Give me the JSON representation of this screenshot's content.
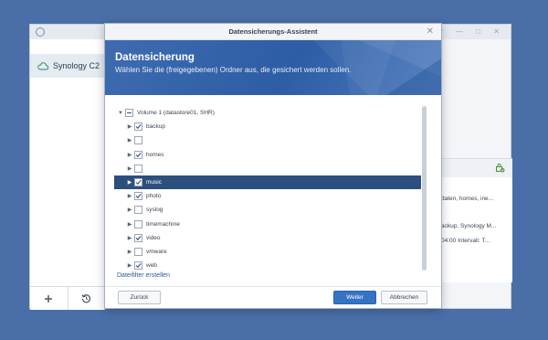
{
  "background_window": {
    "sidebar_item": "Synology C2",
    "right_panel_lines": [
      "daten, homes, ine...",
      "ackup, Synology M...",
      "04:00 Intervall: T..."
    ],
    "window_controls": "? — □ ✕"
  },
  "dialog": {
    "title": "Datensicherungs-Assistent",
    "banner_title": "Datensicherung",
    "banner_subtitle": "Wählen Sie die (freigegebenen) Ordner aus, die gesichert werden sollen.",
    "tree": [
      {
        "label": "Volume 1 (datastore01, SHR)",
        "checked": "partial",
        "caret": "▼",
        "indent": 0,
        "selected": false
      },
      {
        "label": "backup",
        "checked": "true",
        "caret": "▶",
        "indent": 1,
        "selected": false
      },
      {
        "label": "",
        "checked": "false",
        "caret": "▶",
        "indent": 1,
        "selected": false
      },
      {
        "label": "homes",
        "checked": "true",
        "caret": "▶",
        "indent": 1,
        "selected": false
      },
      {
        "label": "",
        "checked": "false",
        "caret": "▶",
        "indent": 1,
        "selected": false
      },
      {
        "label": "music",
        "checked": "true",
        "caret": "▶",
        "indent": 1,
        "selected": true
      },
      {
        "label": "photo",
        "checked": "true",
        "caret": "▶",
        "indent": 1,
        "selected": false
      },
      {
        "label": "syslog",
        "checked": "false",
        "caret": "▶",
        "indent": 1,
        "selected": false
      },
      {
        "label": "timemachine",
        "checked": "false",
        "caret": "▶",
        "indent": 1,
        "selected": false
      },
      {
        "label": "video",
        "checked": "true",
        "caret": "▶",
        "indent": 1,
        "selected": false
      },
      {
        "label": "vmware",
        "checked": "false",
        "caret": "▶",
        "indent": 1,
        "selected": false
      },
      {
        "label": "web",
        "checked": "true",
        "caret": "▶",
        "indent": 1,
        "selected": false
      }
    ],
    "filter_link": "Dateifilter erstellen",
    "back_button": "Zurück",
    "next_button": "Weiter",
    "cancel_button": "Abbrechen",
    "close_glyph": "✕"
  },
  "colors": {
    "desktop": "#4a6fa8",
    "banner": "#2d5da5",
    "selected_row": "#2d4f7e",
    "primary_button": "#3574c2"
  }
}
